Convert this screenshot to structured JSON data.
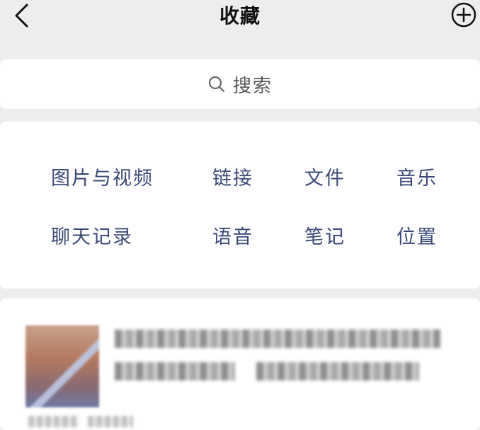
{
  "header": {
    "title": "收藏",
    "back_icon": "chevron-left-icon",
    "add_icon": "plus-circle-icon"
  },
  "search": {
    "placeholder": "搜索",
    "icon": "search-icon"
  },
  "categories": [
    {
      "label": "图片与视频"
    },
    {
      "label": "链接"
    },
    {
      "label": "文件"
    },
    {
      "label": "音乐"
    },
    {
      "label": "聊天记录"
    },
    {
      "label": "语音"
    },
    {
      "label": "笔记"
    },
    {
      "label": "位置"
    }
  ],
  "colors": {
    "background": "#ededed",
    "panel": "#ffffff",
    "category_text": "#3a4a78",
    "title_text": "#111111"
  }
}
